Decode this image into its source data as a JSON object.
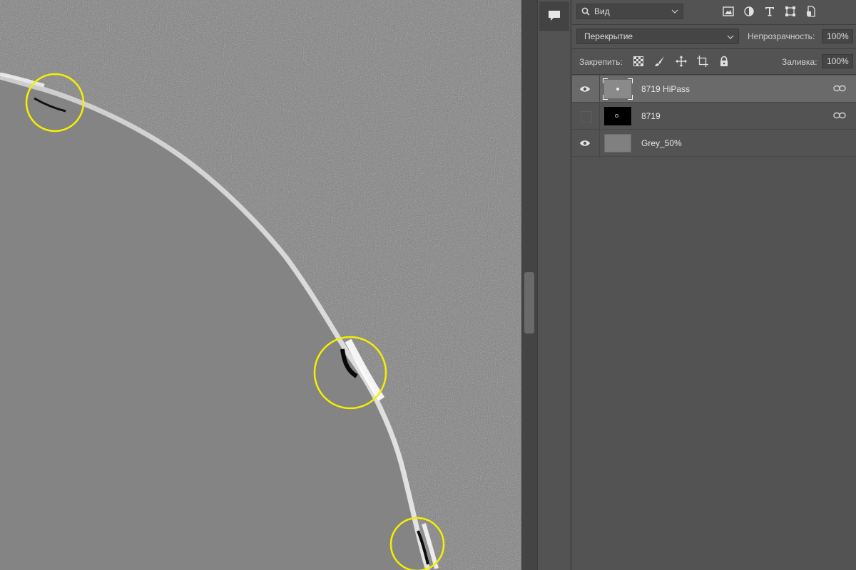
{
  "panel": {
    "filter": {
      "label": "Вид",
      "icon": "search-icon"
    },
    "filter_icons": [
      "pixel-layer-filter-icon",
      "adjustment-layer-filter-icon",
      "type-layer-filter-icon",
      "shape-layer-filter-icon",
      "smart-object-filter-icon"
    ],
    "blend_mode": "Перекрытие",
    "opacity_label": "Непрозрачность:",
    "opacity_value": "100%",
    "lock_label": "Закрепить:",
    "lock_icons": [
      "lock-transparent-pixels-icon",
      "lock-image-pixels-icon",
      "lock-position-icon",
      "lock-artboard-icon",
      "lock-all-icon"
    ],
    "fill_label": "Заливка:",
    "fill_value": "100%"
  },
  "layers": [
    {
      "name": "8719 HiPass",
      "visible": true,
      "selected": true,
      "thumb_color": "#8a8a8a",
      "linked": true
    },
    {
      "name": "8719",
      "visible": false,
      "selected": false,
      "thumb_color": "#000000",
      "linked": true
    },
    {
      "name": "Grey_50%",
      "visible": true,
      "selected": false,
      "thumb_color": "#808080",
      "linked": false
    }
  ],
  "colors": {
    "canvas_grey": "#848484",
    "highlight_circle": "#f4f000",
    "panel_bg": "#535353"
  }
}
